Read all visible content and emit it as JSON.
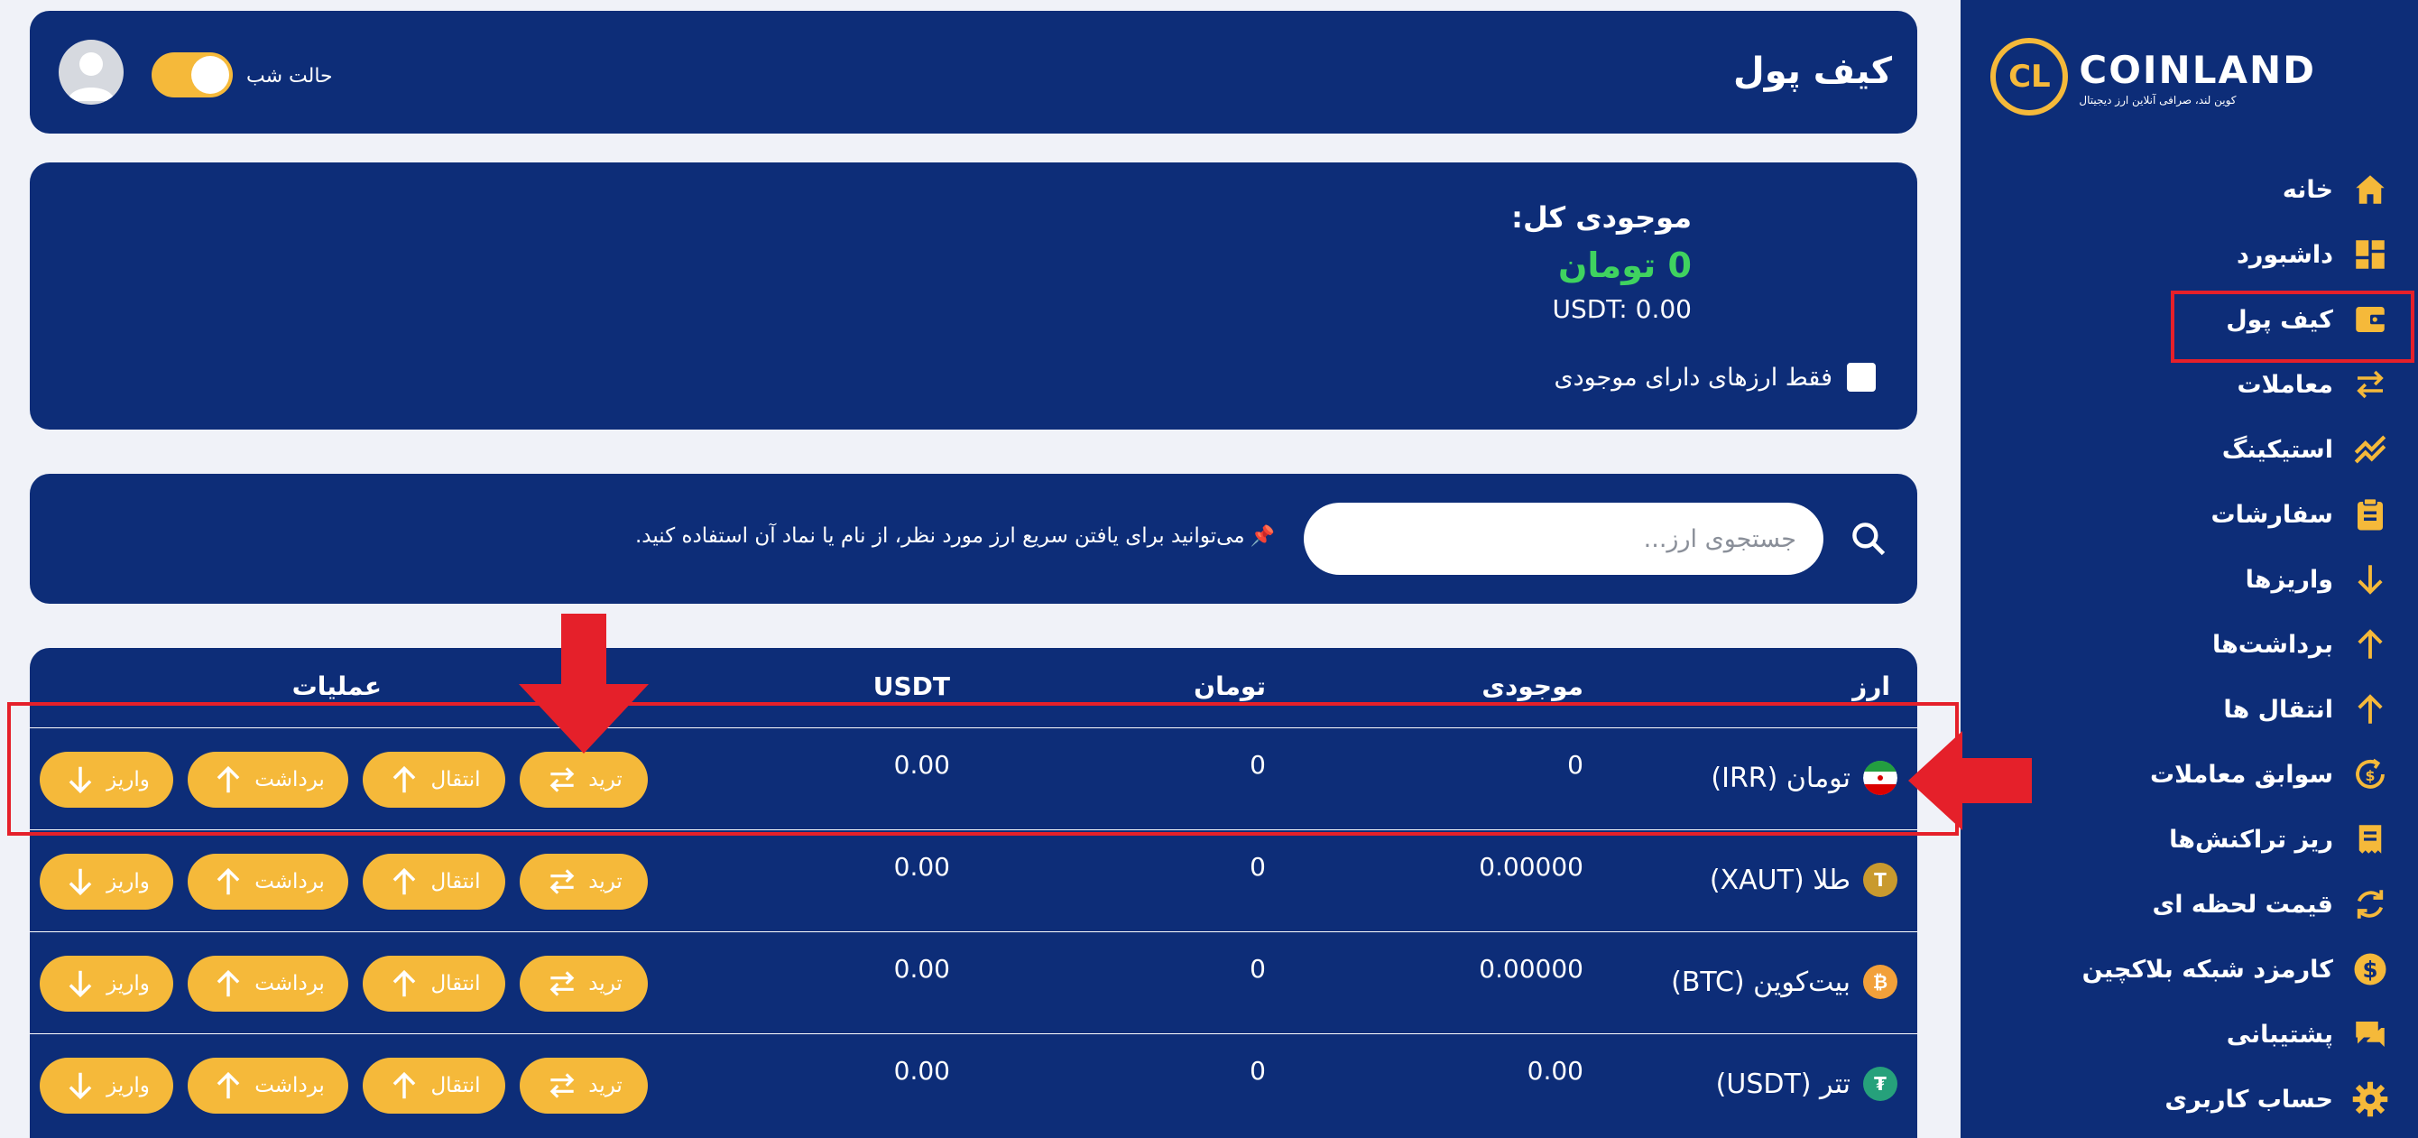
{
  "brand": {
    "name": "COINLAND",
    "tagline": "کوین لند، صرافی آنلاین ارز دیجیتال",
    "accent": "#f5b93a",
    "primary": "#0d2d78",
    "background": "#f0f2f8"
  },
  "sidebar": {
    "items": [
      {
        "label": "خانه",
        "icon": "home-icon"
      },
      {
        "label": "داشبورد",
        "icon": "dashboard-icon"
      },
      {
        "label": "کیف پول",
        "icon": "wallet-icon",
        "active": true
      },
      {
        "label": "معاملات",
        "icon": "swap-icon"
      },
      {
        "label": "استیکینگ",
        "icon": "trend-icon"
      },
      {
        "label": "سفارشات",
        "icon": "clipboard-icon"
      },
      {
        "label": "واریزها",
        "icon": "arrow-down-icon"
      },
      {
        "label": "برداشت‌ها",
        "icon": "arrow-up-icon"
      },
      {
        "label": "انتقال ها",
        "icon": "arrow-up-icon"
      },
      {
        "label": "سوابق معاملات",
        "icon": "history-icon"
      },
      {
        "label": "ریز تراکنش‌ها",
        "icon": "receipt-icon"
      },
      {
        "label": "قیمت لحظه ای",
        "icon": "refresh-icon"
      },
      {
        "label": "کارمزد شبکه بلاکچین",
        "icon": "dollar-icon"
      },
      {
        "label": "پشتیبانی",
        "icon": "chat-icon"
      },
      {
        "label": "حساب کاربری",
        "icon": "gear-icon"
      }
    ]
  },
  "header": {
    "title": "کیف پول",
    "night_mode_label": "حالت شب",
    "night_mode_on": true
  },
  "balance": {
    "title": "موجودی کل:",
    "toman": "0 تومان",
    "usdt": "USDT: 0.00",
    "only_with_balance_label": "فقط ارزهای دارای موجودی",
    "toman_color": "#3fd35f"
  },
  "search": {
    "placeholder": "جستجوی ارز...",
    "hint_pin": "📌",
    "hint": "می‌توانید برای یافتن سریع ارز مورد نظر، از نام یا نماد آن استفاده کنید."
  },
  "table": {
    "headers": {
      "currency": "ارز",
      "balance": "موجودی",
      "toman": "تومان",
      "usdt": "USDT",
      "actions": "عملیات"
    },
    "action_labels": {
      "deposit": "واریز",
      "withdraw": "برداشت",
      "transfer": "انتقال",
      "trade": "ترید"
    },
    "rows": [
      {
        "name": "تومان (IRR)",
        "icon": "iran-flag-icon",
        "balance": "0",
        "toman": "0",
        "usdt": "0.00"
      },
      {
        "name": "طلا (XAUT)",
        "icon": "xaut-icon",
        "balance": "0.00000",
        "toman": "0",
        "usdt": "0.00"
      },
      {
        "name": "بیت‌کوین (BTC)",
        "icon": "bitcoin-icon",
        "balance": "0.00000",
        "toman": "0",
        "usdt": "0.00"
      },
      {
        "name": "تتر (USDT)",
        "icon": "tether-icon",
        "balance": "0.00",
        "toman": "0",
        "usdt": "0.00"
      }
    ]
  },
  "annotation_color": "#e5202a"
}
